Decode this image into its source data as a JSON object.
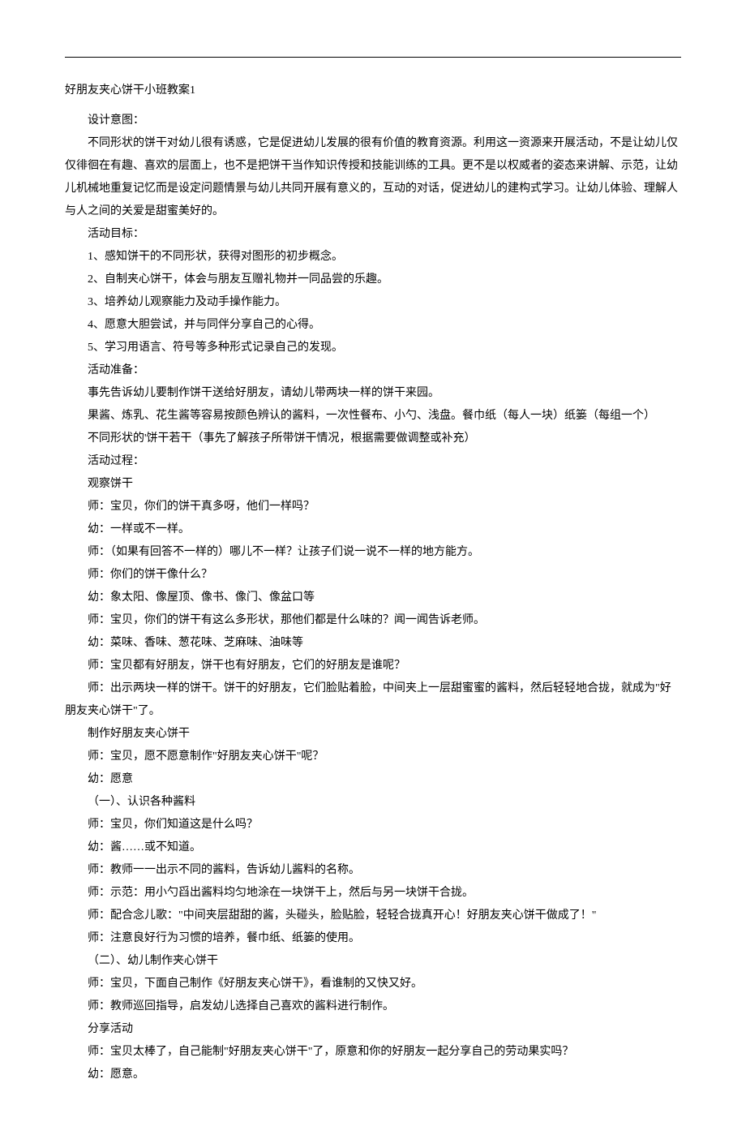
{
  "title": "好朋友夹心饼干小班教案1",
  "sections": {
    "design_intent_heading": "设计意图：",
    "design_intent_body": "不同形状的饼干对幼儿很有诱惑，它是促进幼儿发展的很有价值的教育资源。利用这一资源来开展活动，不是让幼儿仅仅徘徊在有趣、喜欢的层面上，也不是把饼干当作知识传授和技能训练的工具。更不是以权威者的姿态来讲解、示范，让幼儿机械地重复记忆而是设定问题情景与幼儿共同开展有意义的，互动的对话，促进幼儿的建构式学习。让幼儿体验、理解人与人之间的关爱是甜蜜美好的。",
    "goals_heading": "活动目标：",
    "goals": [
      "1、感知饼干的不同形状，获得对图形的初步概念。",
      "2、自制夹心饼干，体会与朋友互赠礼物并一同品尝的乐趣。",
      "3、培养幼儿观察能力及动手操作能力。",
      "4、愿意大胆尝试，并与同伴分享自己的心得。",
      "5、学习用语言、符号等多种形式记录自己的发现。"
    ],
    "prep_heading": "活动准备：",
    "prep": [
      "事先告诉幼儿要制作饼干送给好朋友，请幼儿带两块一样的饼干来园。",
      "果酱、炼乳、花生酱等容易按颜色辨认的酱料，一次性餐布、小勺、浅盘。餐巾纸（每人一块）纸篓（每组一个）",
      "不同形状的'饼干若干（事先了解孩子所带饼干情况，根据需要做调整或补充）"
    ],
    "process_heading": "活动过程：",
    "observe_heading": "观察饼干",
    "dialogue1": [
      "师：宝贝，你们的饼干真多呀，他们一样吗？",
      "幼：一样或不一样。",
      "师：（如果有回答不一样的）哪儿不一样？让孩子们说一说不一样的地方能方。",
      "师：你们的饼干像什么？",
      "幼：象太阳、像屋顶、像书、像门、像盆口等",
      "师：宝贝，你们的饼干有这么多形状，那他们都是什么味的？闻一闻告诉老师。",
      "幼：菜味、香味、葱花味、芝麻味、油味等",
      "师：宝贝都有好朋友，饼干也有好朋友，它们的好朋友是谁呢？"
    ],
    "demo_line": "师：出示两块一样的饼干。饼干的好朋友，它们脸贴着脸，中间夹上一层甜蜜蜜的酱料，然后轻轻地合拢，就成为\"好朋友夹心饼干\"了。",
    "make_heading": "制作好朋友夹心饼干",
    "dialogue2": [
      "师：宝贝，愿不愿意制作\"好朋友夹心饼干\"呢？",
      "幼：愿意",
      "（一）、认识各种酱料",
      "师：宝贝，你们知道这是什么吗？",
      "幼：酱……或不知道。",
      "师：教师一一出示不同的酱料，告诉幼儿酱料的名称。",
      "师：示范：用小勺舀出酱料均匀地涂在一块饼干上，然后与另一块饼干合拢。",
      "师：配合念儿歌：\"中间夹层甜甜的酱，头碰头，脸贴脸，轻轻合拢真开心！好朋友夹心饼干做成了！\"",
      "师：注意良好行为习惯的培养，餐巾纸、纸篓的使用。",
      "（二）、幼儿制作夹心饼干",
      "师：宝贝，下面自己制作《好朋友夹心饼干》，看谁制的又快又好。",
      "师：教师巡回指导，启发幼儿选择自己喜欢的酱料进行制作。"
    ],
    "share_heading": "分享活动",
    "dialogue3": [
      "师：宝贝太棒了，自己能制\"好朋友夹心饼干\"了，原意和你的好朋友一起分享自己的劳动果实吗？",
      "幼：愿意。"
    ]
  }
}
